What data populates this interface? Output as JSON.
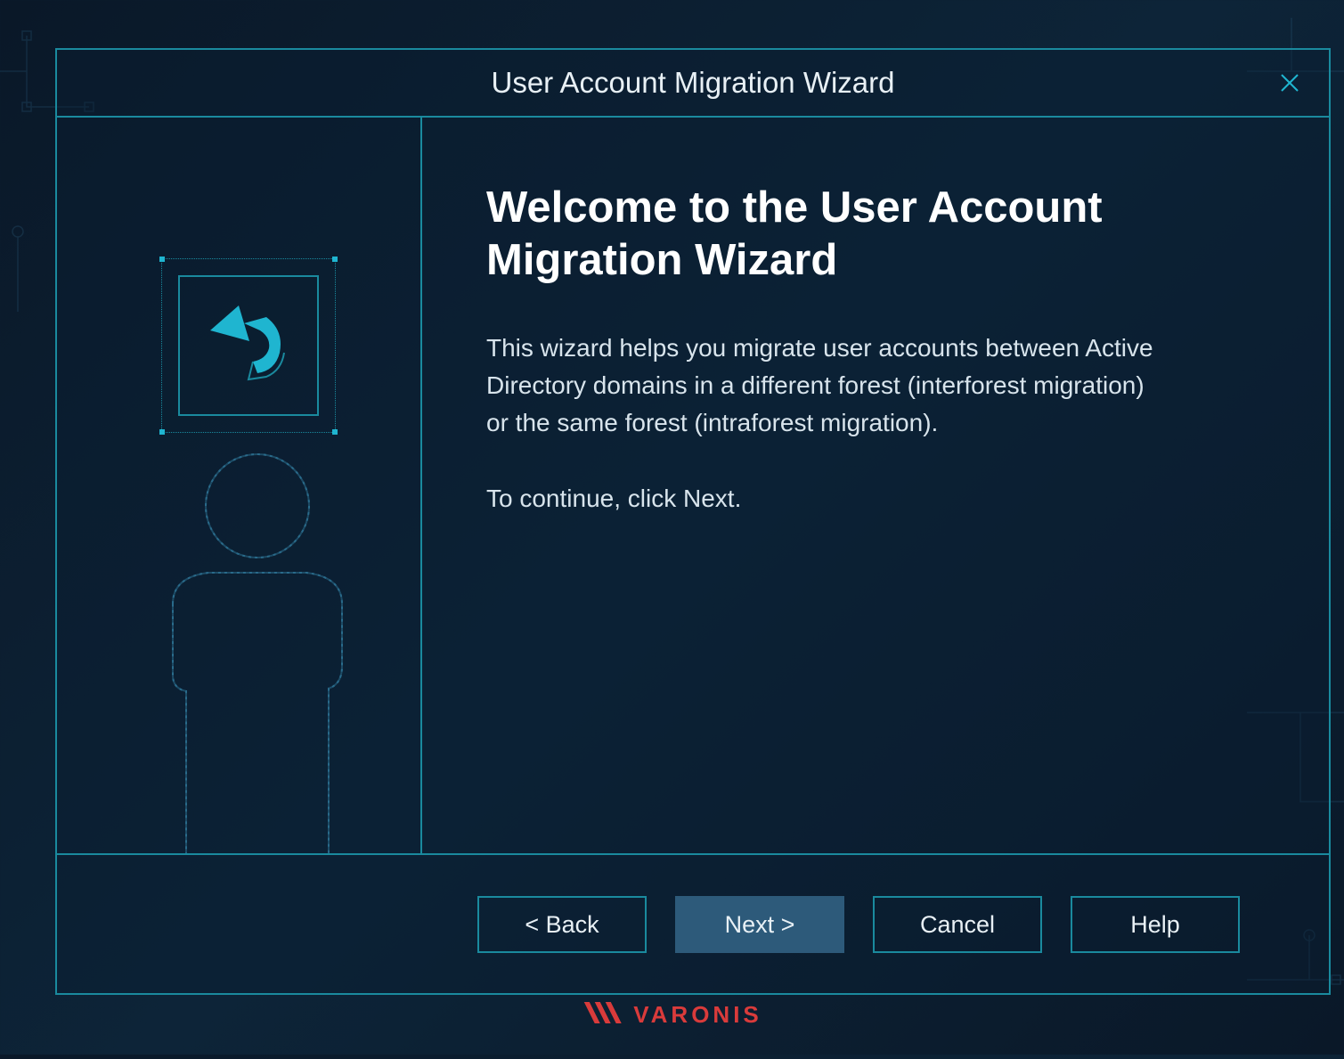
{
  "window": {
    "title": "User Account Migration Wizard"
  },
  "content": {
    "heading": "Welcome to the User Account Migration Wizard",
    "description": "This wizard helps you migrate user accounts between Active Directory domains in a different forest (interforest migration) or the same forest (intraforest migration).",
    "continue_prompt": "To continue, click Next."
  },
  "buttons": {
    "back": "< Back",
    "next": "Next >",
    "cancel": "Cancel",
    "help": "Help"
  },
  "footer": {
    "brand": "VARONIS"
  }
}
